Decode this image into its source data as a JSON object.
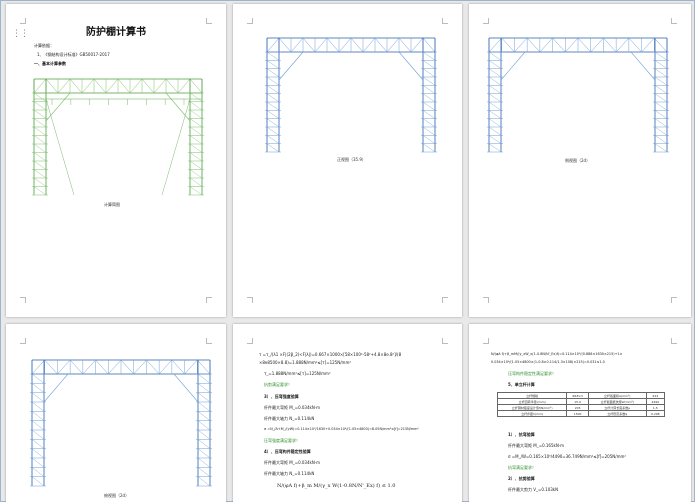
{
  "page1": {
    "title": "防护棚计算书",
    "basis_label": "计算依据：",
    "basis_item": "1、《钢结构设计标准》GB50017-2017",
    "section1": "一、基本计算参数",
    "caption": "计算简图"
  },
  "page2": {
    "caption": "正视图（35.9）"
  },
  "page3": {
    "caption": "侧视图（2d）"
  },
  "page4": {
    "caption": "俯视图（2d）"
  },
  "page5": {
    "line1": "τ =τ_/(λ1 ×F|(2β_2)<F|λ|)=0.667×1000×[58×100²-58²+4.8×8e.8²]/(8",
    "line2": "×8e8500×8.8)=1.888N/mm²≤[τ]=125N/mm²",
    "line3": "τ_=1.888N/mm²≤[τ]=125N/mm²",
    "check1": "抗剪满足要求！",
    "h3": "3）、压弯强度验算",
    "m1": "杆件最大弯矩 M_=0.034kN·m",
    "n1": "杆件最大轴力 N_=0.114kN",
    "sigma1": "σ =N_/A+M_/(γW)=0.114×10³/1630+0.034×10⁶/(1.05×4800)=8.05N/mm²≤[f]=215N/mm²",
    "check2": "压弯强度满足要求！",
    "h4": "4）、压弯构件稳定性验算",
    "m2": "杆件最大弯矩 M_=0.034kN·m",
    "n2": "杆件最大轴力 N_=0.114kN",
    "formula": "N/(φA f)+β_m M/(γ_x W(1-0.8N/N'_Ex) f) ≤ 1.0"
  },
  "page6": {
    "line1": "N/(φA f)+β_mM/(γ_xW_x(1-0.8N/N'_Ex)f)=0.114×10³/(0.886×1630×215)+1×",
    "line2": "0.034×10⁶/(1.05×4800×(1-0.8×0.114/1.3×108)×215)=0.031≤1.0",
    "check1": "压弯构件稳定性满足要求！",
    "h5": "5、单立杆计算",
    "table": [
      [
        "立杆规格",
        "Φ48×3",
        "立杆截面积A(mm²)",
        "424"
      ],
      [
        "立杆回转半径i(mm)",
        "15.9",
        "立杆截面抵抗矩W(mm³)",
        "4490"
      ],
      [
        "立杆钢材强度设计值f(N/mm²)",
        "205",
        "立杆计算长度系数μ",
        "1.5"
      ],
      [
        "立杆步距h(mm)",
        "1500",
        "立杆稳定系数φ",
        "0.298"
      ]
    ],
    "h1": "1）、抗弯验算",
    "m1": "杆件最大弯矩 M_=0.165kN·m",
    "sigma": "σ =M_/W=0.165×10⁶/4490=36.749N/mm²≤[f]=205N/mm²",
    "check2": "抗弯满足要求！",
    "h2": "2）、抗剪验算",
    "v1": "杆件最大剪力 V_=0.103kN"
  },
  "colors": {
    "truss": "#6f9fd8",
    "member": "#2b5fa8",
    "green": "#2a8f2a",
    "background": "#e9e9e9"
  }
}
